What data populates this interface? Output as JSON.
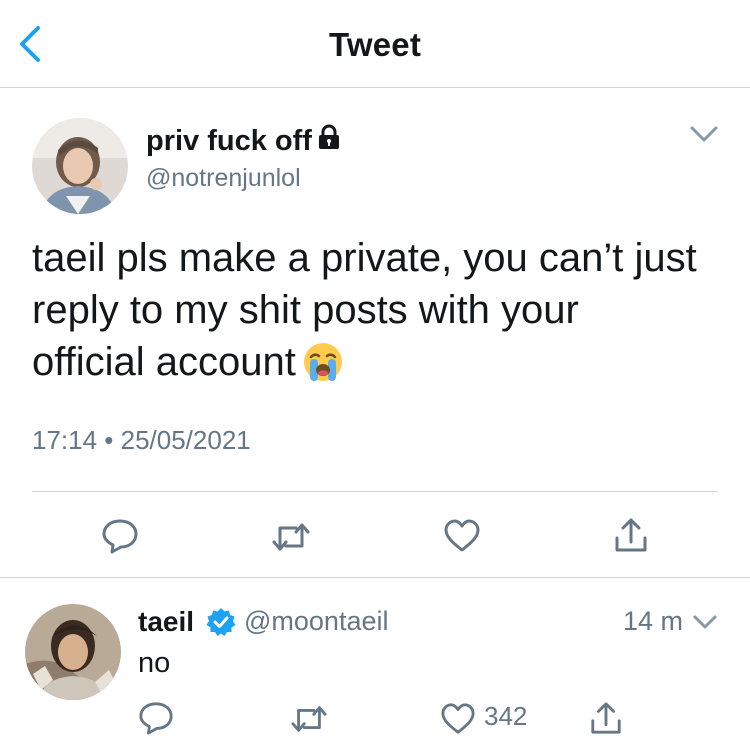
{
  "header": {
    "title": "Tweet"
  },
  "main_tweet": {
    "display_name": "priv fuck off",
    "handle": "@notrenjunlol",
    "lines": [
      "taeil pls make a private, you can’t just",
      "reply to my shit posts with your",
      "official account"
    ],
    "emoji": "loudly-crying-face",
    "timestamp": "17:14 • 25/05/2021"
  },
  "reply": {
    "display_name": "taeil",
    "handle": "@moontaeil",
    "time": "14 m",
    "text": "no",
    "like_count": "342"
  },
  "icons": {
    "back": "chevron-left-icon",
    "more": "chevron-down-icon",
    "lock": "lock-icon",
    "verified": "verified-badge-icon",
    "reply": "reply-icon",
    "retweet": "retweet-icon",
    "like": "heart-icon",
    "share": "share-icon"
  },
  "colors": {
    "accent": "#1da1f2",
    "text": "#14171a",
    "muted": "#657786",
    "divider": "#cfd6dc"
  }
}
